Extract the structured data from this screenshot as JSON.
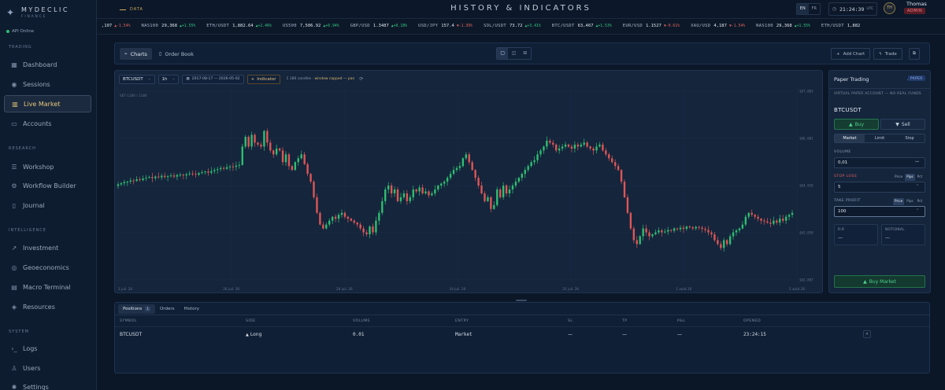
{
  "brand": {
    "name": "MYDECLIC",
    "sub": "FINANCE"
  },
  "api_status": "API Online",
  "nav": {
    "sections": [
      {
        "title": "TRADING",
        "items": [
          {
            "label": "Dashboard",
            "icon": "grid-icon",
            "active": false
          },
          {
            "label": "Sessions",
            "icon": "broadcast-icon",
            "active": false
          },
          {
            "label": "Live Market",
            "icon": "chart-icon",
            "active": true
          },
          {
            "label": "Accounts",
            "icon": "wallet-icon",
            "active": false
          }
        ]
      },
      {
        "title": "RESEARCH",
        "items": [
          {
            "label": "Workshop",
            "icon": "list-icon",
            "active": false
          },
          {
            "label": "Workflow Builder",
            "icon": "gear-icon",
            "active": false
          },
          {
            "label": "Journal",
            "icon": "book-icon",
            "active": false
          }
        ]
      },
      {
        "title": "INTELLIGENCE",
        "items": [
          {
            "label": "Investment",
            "icon": "trend-icon",
            "active": false
          },
          {
            "label": "Geoeconomics",
            "icon": "globe-icon",
            "active": false
          },
          {
            "label": "Macro Terminal",
            "icon": "terminal-icon",
            "active": false
          },
          {
            "label": "Resources",
            "icon": "layers-icon",
            "active": false
          }
        ]
      },
      {
        "title": "SYSTEM",
        "items": [
          {
            "label": "Logs",
            "icon": "prompt-icon",
            "active": false
          },
          {
            "label": "Users",
            "icon": "users-icon",
            "active": false
          },
          {
            "label": "Settings",
            "icon": "cog-icon",
            "active": false
          }
        ]
      }
    ]
  },
  "topbar": {
    "data_tag": "DATA",
    "title": "HISTORY & INDICATORS",
    "langs": [
      "EN",
      "FR"
    ],
    "active_lang": "EN",
    "clock": "21:24:39",
    "tz": "UTC",
    "avatar": "TH",
    "user_name": "Thomas",
    "user_role": "ADMIN"
  },
  "ticker": [
    {
      "sym": "",
      "px": ",107",
      "ch": "▲-1.54%",
      "dir": "dn"
    },
    {
      "sym": "NAS100",
      "px": "29,368",
      "ch": "▲+1.55%",
      "dir": "up"
    },
    {
      "sym": "ETH/USDT",
      "px": "1,882.64",
      "ch": "▲+2.46%",
      "dir": "up"
    },
    {
      "sym": "US500",
      "px": "7,506.92",
      "ch": "▲+0.94%",
      "dir": "up"
    },
    {
      "sym": "GBP/USD",
      "px": "1.3487",
      "ch": "▲+0.18%",
      "dir": "up"
    },
    {
      "sym": "USD/JPY",
      "px": "157.4",
      "ch": "▼-1.39%",
      "dir": "dn"
    },
    {
      "sym": "SOL/USDT",
      "px": "73.72",
      "ch": "▲+3.41%",
      "dir": "up"
    },
    {
      "sym": "BTC/USDT",
      "px": "63,467",
      "ch": "▲+1.53%",
      "dir": "up"
    },
    {
      "sym": "EUR/USD",
      "px": "1.1527",
      "ch": "▼-0.61%",
      "dir": "dn"
    },
    {
      "sym": "XAU/USD",
      "px": "4,187",
      "ch": "▼-1.54%",
      "dir": "dn"
    },
    {
      "sym": "NAS100",
      "px": "29,368",
      "ch": "▲+1.55%",
      "dir": "up"
    },
    {
      "sym": "ETH/USDT",
      "px": "1,882",
      "ch": "",
      "dir": "up"
    }
  ],
  "toolbar": {
    "tabs": [
      {
        "label": "Charts",
        "icon": "chart-line-icon",
        "active": true
      },
      {
        "label": "Order Book",
        "icon": "book-icon",
        "active": false
      }
    ],
    "add_chart": "Add Chart",
    "trade": "Trade"
  },
  "chart": {
    "symbol": "BTCUSDT",
    "interval": "1h",
    "date_range": "2017-08-17 — 2026-05-02",
    "indicator": "Indicator",
    "candles_prefix": "1 180 candles ·",
    "candles_note": "window capped — pan",
    "ohlc_label": "SET·1180 / 1180"
  },
  "chart_data": {
    "type": "candlestick",
    "y_ticks": [
      "$67,003",
      "$66,001",
      "$64,918",
      "$63,858",
      "$62,887"
    ],
    "ylim": [
      62400,
      67400
    ],
    "x_ticks": [
      "2 juil. 26",
      "26 juil. 26",
      "28 juil. 26",
      "24 juil. 26",
      "31 juil. 26",
      "1 août 26",
      "2 août 26"
    ],
    "close": [
      64930,
      64960,
      64990,
      65000,
      65030,
      65020,
      65060,
      65040,
      65080,
      65100,
      65120,
      65090,
      65130,
      65110,
      65150,
      65120,
      65140,
      65160,
      65130,
      65170,
      65180,
      65160,
      65190,
      65210,
      65200,
      65180,
      65220,
      65240,
      65260,
      65230,
      65270,
      65300,
      65320,
      65350,
      65330,
      65370,
      65390,
      65380,
      65410,
      65430,
      65900,
      66150,
      65900,
      66200,
      66000,
      65950,
      65900,
      66300,
      66000,
      65800,
      65700,
      65850,
      65800,
      65500,
      65700,
      65400,
      65300,
      65500,
      65600,
      65700,
      65450,
      65200,
      65000,
      64600,
      64200,
      63900,
      63800,
      63900,
      64000,
      64100,
      64050,
      64150,
      64200,
      64100,
      64050,
      64000,
      63950,
      63900,
      63800,
      63700,
      63650,
      63850,
      63700,
      64000,
      64200,
      64500,
      64800,
      64900,
      64700,
      64800,
      64500,
      64600,
      64700,
      64500,
      64600,
      64800,
      64750,
      64850,
      64700,
      64750,
      64650,
      64700,
      64800,
      64900,
      64950,
      65000,
      65100,
      65200,
      65300,
      65350,
      65400,
      65600,
      65700,
      65500,
      65300,
      65100,
      64900,
      64700,
      64500,
      64600,
      64300,
      64400,
      64800,
      64600,
      64900,
      64700,
      64800,
      64900,
      65000,
      65100,
      65200,
      65300,
      65400,
      65500,
      65550,
      65700,
      65800,
      65900,
      66050,
      66000,
      65950,
      65800,
      65850,
      65900,
      65950,
      65900,
      65850,
      65950,
      65900,
      65950,
      66000,
      65900,
      65850,
      65800,
      65900,
      65950,
      65800,
      65700,
      65600,
      65500,
      65400,
      65300,
      65000,
      64600,
      64200,
      63800,
      63500,
      63400,
      63600,
      63800,
      63700,
      63600,
      63650,
      63700,
      63750,
      63700,
      63720,
      63760,
      63740,
      63800,
      63780,
      63820,
      63790,
      63850,
      63830,
      63800,
      63840,
      63820,
      63790,
      63760,
      63700,
      63650,
      63500,
      63400,
      63300,
      63500,
      63400,
      63600,
      63700,
      63750,
      63800,
      63900,
      64100,
      64200,
      64150,
      64100,
      64050,
      64000,
      63980,
      63950,
      63920,
      64000,
      63950,
      64050,
      64000,
      64100,
      64150,
      64200
    ],
    "title": "",
    "xlabel": "",
    "ylabel": ""
  },
  "trade": {
    "account": "Paper Trading",
    "mode": "PAPER",
    "note": "VIRTUAL PAPER ACCOUNT — NO REAL FUNDS",
    "symbol": "BTCUSDT",
    "buy": "Buy",
    "sell": "Sell",
    "order_types": [
      "Market",
      "Limit",
      "Stop"
    ],
    "active_order_type": "Market",
    "volume_label": "VOLUME",
    "volume": "0,01",
    "sl_label": "STOP LOSS",
    "sl_units": [
      "Price",
      "Pips",
      "Pct"
    ],
    "sl_unit_active": "Pips",
    "sl_value": "5",
    "tp_label": "TAKE PROFIT",
    "tp_units": [
      "Price",
      "Pips",
      "Pct"
    ],
    "tp_unit_active": "Price",
    "tp_value": "100",
    "rr_label": "R:R",
    "rr_value": "—",
    "notional_label": "NOTIONAL",
    "notional_value": "—",
    "submit": "Buy Market"
  },
  "positions": {
    "tabs": [
      {
        "label": "Positions",
        "count": "1",
        "active": true
      },
      {
        "label": "Orders",
        "count": "",
        "active": false
      },
      {
        "label": "History",
        "count": "",
        "active": false
      }
    ],
    "columns": [
      "SYMBOL",
      "SIDE",
      "VOLUME",
      "ENTRY",
      "SL",
      "TP",
      "P&L",
      "OPENED"
    ],
    "rows": [
      {
        "symbol": "BTCUSDT",
        "side": "Long",
        "volume": "0.01",
        "entry": "Market",
        "sl": "—",
        "tp": "—",
        "pnl": "—",
        "opened": "23:24:15"
      }
    ]
  }
}
